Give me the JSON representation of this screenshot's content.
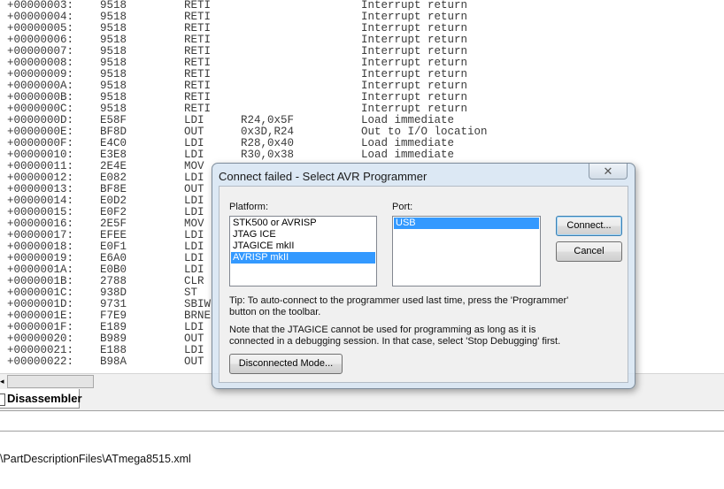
{
  "disassembler": {
    "rows": [
      {
        "addr": "+00000003:",
        "op": "9518",
        "mn": "RETI",
        "arg": "",
        "cm": "Interrupt return"
      },
      {
        "addr": "+00000004:",
        "op": "9518",
        "mn": "RETI",
        "arg": "",
        "cm": "Interrupt return"
      },
      {
        "addr": "+00000005:",
        "op": "9518",
        "mn": "RETI",
        "arg": "",
        "cm": "Interrupt return"
      },
      {
        "addr": "+00000006:",
        "op": "9518",
        "mn": "RETI",
        "arg": "",
        "cm": "Interrupt return"
      },
      {
        "addr": "+00000007:",
        "op": "9518",
        "mn": "RETI",
        "arg": "",
        "cm": "Interrupt return"
      },
      {
        "addr": "+00000008:",
        "op": "9518",
        "mn": "RETI",
        "arg": "",
        "cm": "Interrupt return"
      },
      {
        "addr": "+00000009:",
        "op": "9518",
        "mn": "RETI",
        "arg": "",
        "cm": "Interrupt return"
      },
      {
        "addr": "+0000000A:",
        "op": "9518",
        "mn": "RETI",
        "arg": "",
        "cm": "Interrupt return"
      },
      {
        "addr": "+0000000B:",
        "op": "9518",
        "mn": "RETI",
        "arg": "",
        "cm": "Interrupt return"
      },
      {
        "addr": "+0000000C:",
        "op": "9518",
        "mn": "RETI",
        "arg": "",
        "cm": "Interrupt return"
      },
      {
        "addr": "+0000000D:",
        "op": "E58F",
        "mn": "LDI",
        "arg": "R24,0x5F",
        "cm": "Load immediate"
      },
      {
        "addr": "+0000000E:",
        "op": "BF8D",
        "mn": "OUT",
        "arg": "0x3D,R24",
        "cm": "Out to I/O location"
      },
      {
        "addr": "+0000000F:",
        "op": "E4C0",
        "mn": "LDI",
        "arg": "R28,0x40",
        "cm": "Load immediate"
      },
      {
        "addr": "+00000010:",
        "op": "E3E8",
        "mn": "LDI",
        "arg": "R30,0x38",
        "cm": "Load immediate"
      },
      {
        "addr": "+00000011:",
        "op": "2E4E",
        "mn": "MOV",
        "arg": "",
        "cm": ""
      },
      {
        "addr": "+00000012:",
        "op": "E082",
        "mn": "LDI",
        "arg": "",
        "cm": ""
      },
      {
        "addr": "+00000013:",
        "op": "BF8E",
        "mn": "OUT",
        "arg": "",
        "cm": ""
      },
      {
        "addr": "+00000014:",
        "op": "E0D2",
        "mn": "LDI",
        "arg": "",
        "cm": ""
      },
      {
        "addr": "+00000015:",
        "op": "E0F2",
        "mn": "LDI",
        "arg": "",
        "cm": ""
      },
      {
        "addr": "+00000016:",
        "op": "2E5F",
        "mn": "MOV",
        "arg": "",
        "cm": ""
      },
      {
        "addr": "+00000017:",
        "op": "EFEE",
        "mn": "LDI",
        "arg": "",
        "cm": ""
      },
      {
        "addr": "+00000018:",
        "op": "E0F1",
        "mn": "LDI",
        "arg": "",
        "cm": ""
      },
      {
        "addr": "+00000019:",
        "op": "E6A0",
        "mn": "LDI",
        "arg": "",
        "cm": ""
      },
      {
        "addr": "+0000001A:",
        "op": "E0B0",
        "mn": "LDI",
        "arg": "",
        "cm": ""
      },
      {
        "addr": "+0000001B:",
        "op": "2788",
        "mn": "CLR",
        "arg": "",
        "cm": ""
      },
      {
        "addr": "+0000001C:",
        "op": "938D",
        "mn": "ST",
        "arg": "",
        "cm": ""
      },
      {
        "addr": "+0000001D:",
        "op": "9731",
        "mn": "SBIW",
        "arg": "",
        "cm": ""
      },
      {
        "addr": "+0000001E:",
        "op": "F7E9",
        "mn": "BRNE",
        "arg": "",
        "cm": ""
      },
      {
        "addr": "+0000001F:",
        "op": "E189",
        "mn": "LDI",
        "arg": "",
        "cm": ""
      },
      {
        "addr": "+00000020:",
        "op": "B989",
        "mn": "OUT",
        "arg": "",
        "cm": ""
      },
      {
        "addr": "+00000021:",
        "op": "E188",
        "mn": "LDI",
        "arg": "",
        "cm": ""
      },
      {
        "addr": "+00000022:",
        "op": "B98A",
        "mn": "OUT",
        "arg": "",
        "cm": ""
      }
    ],
    "scroll_arrow": "◂",
    "tab_label": "Disassembler"
  },
  "status": {
    "path": "\\PartDescriptionFiles\\ATmega8515.xml"
  },
  "dialog": {
    "title": "Connect failed - Select AVR Programmer",
    "close_glyph": "✕",
    "platform_label": "Platform:",
    "port_label": "Port:",
    "platforms": [
      "STK500 or AVRISP",
      "JTAG ICE",
      "JTAGICE mkII",
      "AVRISP mkII"
    ],
    "selected_platform": "AVRISP mkII",
    "ports": [
      "USB"
    ],
    "selected_port": "USB",
    "connect_label": "Connect...",
    "cancel_label": "Cancel",
    "tip_line1": "Tip: To auto-connect to the programmer used last time, press the 'Programmer'",
    "tip_line2": "button on the toolbar.",
    "note_line1": "Note that the JTAGICE cannot be used for programming as long as it is",
    "note_line2": "connected in a debugging session. In that case, select 'Stop Debugging' first.",
    "disconnected_label": "Disconnected Mode..."
  },
  "colors": {
    "selection": "#3399ff",
    "dialog_frame": "#d6e4f2"
  }
}
